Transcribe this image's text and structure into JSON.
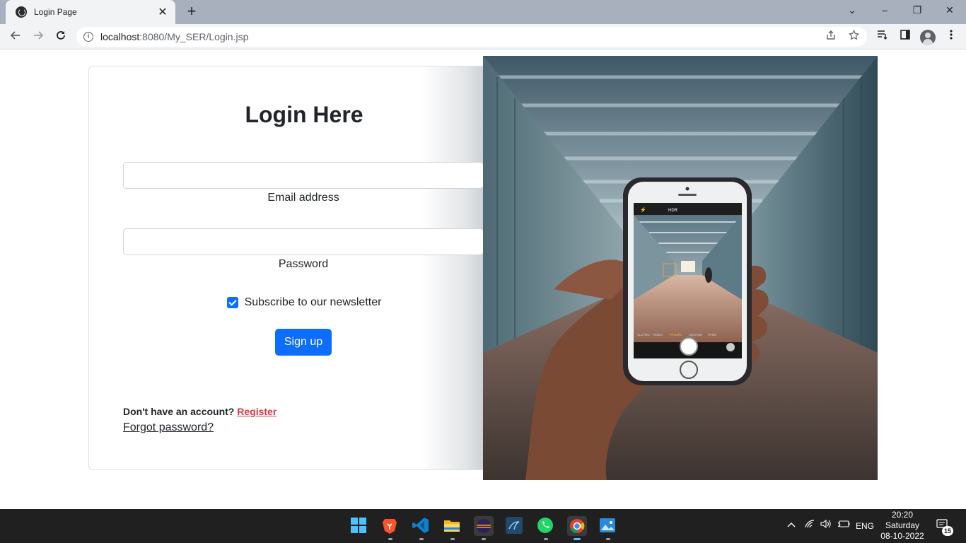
{
  "browser": {
    "tab_title": "Login Page",
    "tab_close": "✕",
    "new_tab": "+",
    "url_host": "localhost",
    "url_path": ":8080/My_SER/Login.jsp",
    "window_controls": [
      "⌄",
      "–",
      "❐",
      "✕"
    ]
  },
  "login": {
    "heading": "Login Here",
    "email_label": "Email address",
    "email_value": "",
    "password_label": "Password",
    "password_value": "",
    "newsletter_label": "Subscribe to our newsletter",
    "newsletter_checked": true,
    "signup_label": "Sign up",
    "no_account_text": "Don't have an account?",
    "register_label": "Register",
    "forgot_label": "Forgot password?"
  },
  "taskbar": {
    "language": "ENG",
    "time": "20:20",
    "day": "Saturday",
    "date": "08-10-2022",
    "notification_count": "15"
  },
  "colors": {
    "primary": "#0d6efd",
    "danger": "#dc3545",
    "taskbar": "#202020"
  }
}
